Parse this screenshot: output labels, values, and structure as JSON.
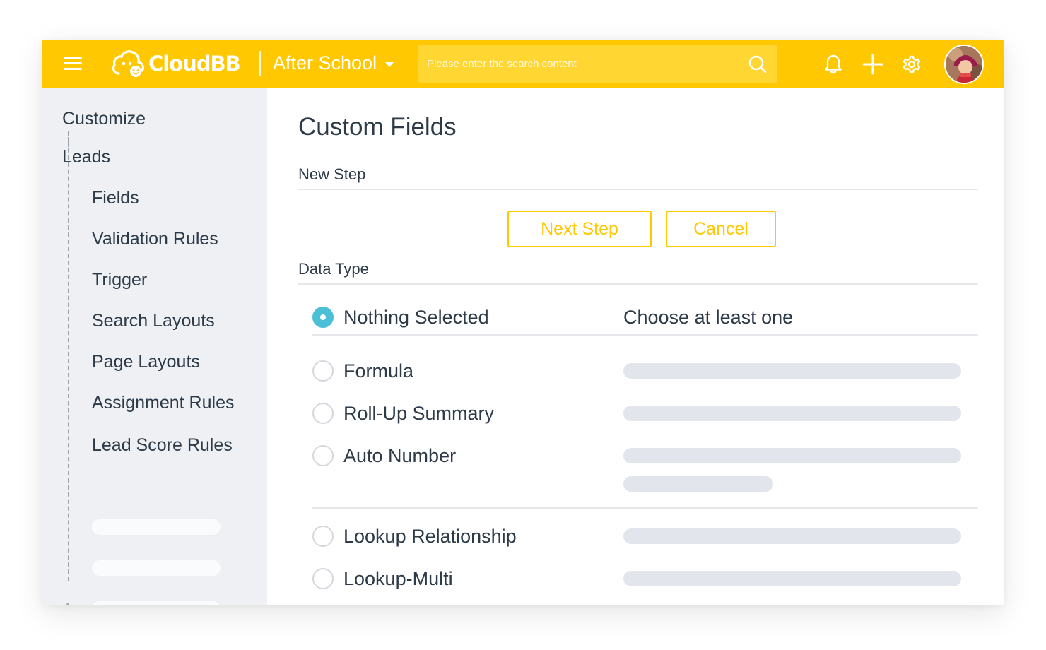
{
  "header": {
    "brand": "CloudBB",
    "org_name": "After School",
    "search_placeholder": "Please enter the search content",
    "icons": [
      "menu-icon",
      "search-icon",
      "bell-icon",
      "plus-icon",
      "gear-icon"
    ],
    "accent_color": "#ffc800"
  },
  "sidebar": {
    "root_label": "Customize",
    "section_label": "Leads",
    "items": [
      {
        "label": "Fields"
      },
      {
        "label": "Validation Rules"
      },
      {
        "label": "Trigger"
      },
      {
        "label": "Search Layouts"
      },
      {
        "label": "Page Layouts"
      },
      {
        "label": "Assignment Rules"
      },
      {
        "label": "Lead Score Rules"
      }
    ]
  },
  "main": {
    "title": "Custom Fields",
    "step_label": "New Step",
    "next_button": "Next Step",
    "cancel_button": "Cancel",
    "data_type_label": "Data Type",
    "options": [
      {
        "label": "Nothing Selected",
        "selected": true,
        "note": "Choose at least one"
      },
      {
        "label": "Formula",
        "selected": false
      },
      {
        "label": "Roll-Up Summary",
        "selected": false
      },
      {
        "label": "Auto Number",
        "selected": false
      },
      {
        "label": "Lookup Relationship",
        "selected": false
      },
      {
        "label": "Lookup-Multi",
        "selected": false
      }
    ],
    "radio_selected_color": "#4bbfd6"
  }
}
